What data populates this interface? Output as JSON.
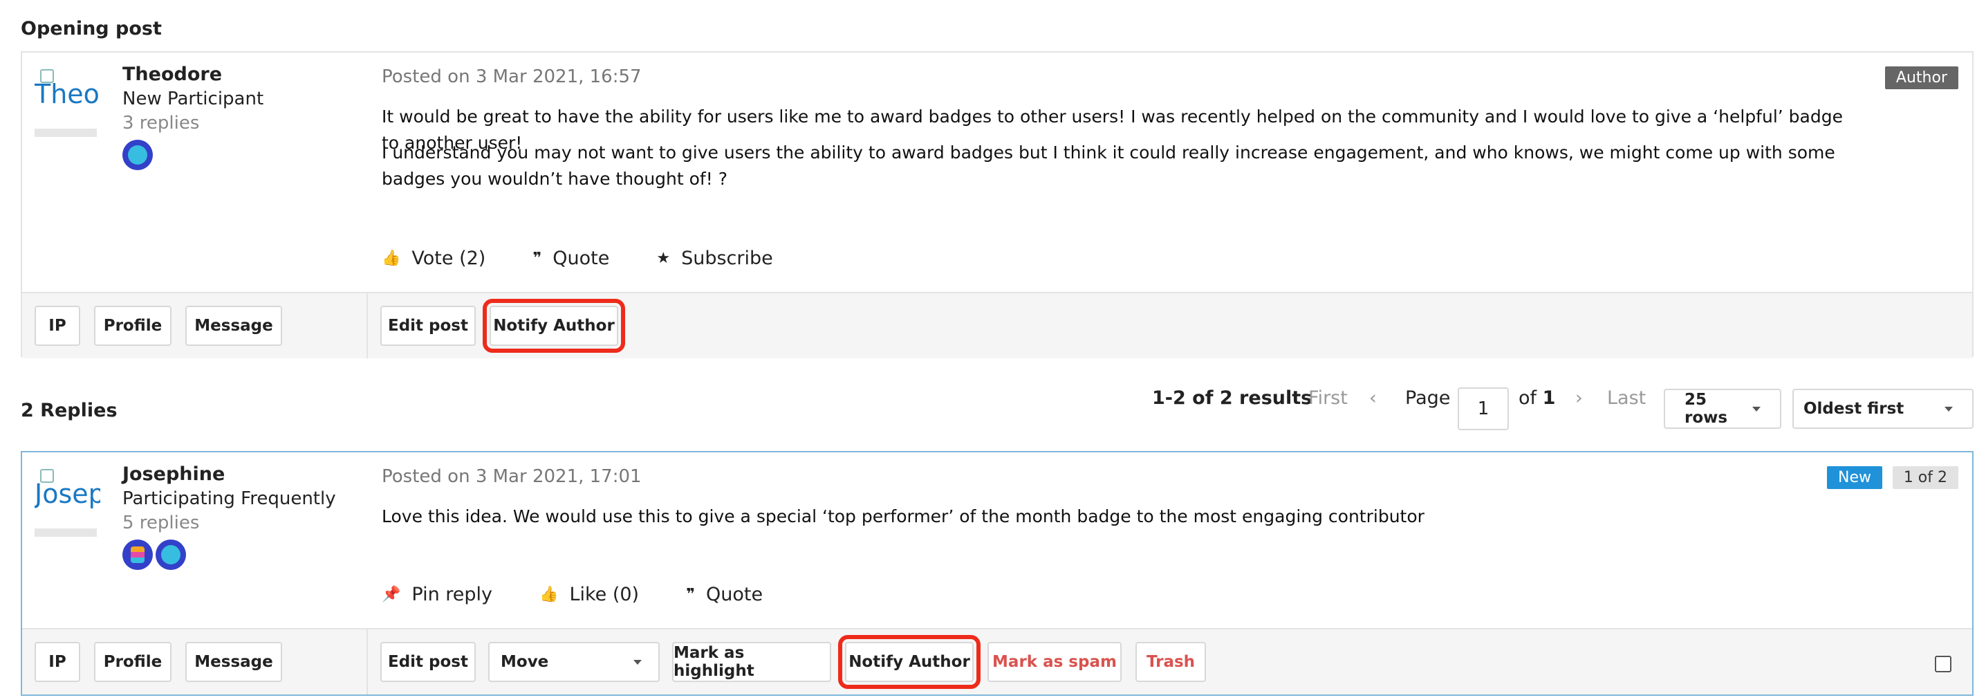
{
  "opening_heading": "Opening post",
  "replies_heading": "2 Replies",
  "opening": {
    "avatar_alt": "Theodore",
    "name": "Theodore",
    "rank": "New Participant",
    "replies": "3 replies",
    "posted": "Posted on 3 Mar 2021, 16:57",
    "tag": "Author",
    "text1": "It would be great to have the ability for users like me to award badges to other users! I was recently helped on the community and I would love to give a ‘helpful’ badge to another user!",
    "text2": "I understand you may not want to give users the ability to award badges but I think it could really increase engagement, and who knows, we might come up with some badges you wouldn’t have thought of! ?",
    "actions": [
      "Vote (2)",
      "Quote",
      "Subscribe"
    ],
    "left_buttons": [
      "IP",
      "Profile",
      "Message"
    ],
    "edit": "Edit post",
    "notify": "Notify Author"
  },
  "pager": {
    "results": "1-2 of 2 results",
    "first": "First",
    "page_label": "Page",
    "page_value": "1",
    "of": "of",
    "total": "1",
    "last": "Last",
    "rows": "25 rows",
    "sort": "Oldest first"
  },
  "reply": {
    "avatar_alt": "Josephine",
    "name": "Josephine",
    "rank": "Participating Frequently",
    "replies": "5 replies",
    "posted": "Posted on 3 Mar 2021, 17:01",
    "tag_new": "New",
    "tag_count": "1 of 2",
    "text": "Love this idea. We would use this to give a special ‘top performer’ of the month badge to the most engaging contributor",
    "actions": [
      "Pin reply",
      "Like (0)",
      "Quote"
    ],
    "left_buttons": [
      "IP",
      "Profile",
      "Message"
    ],
    "edit": "Edit post",
    "move": "Move",
    "highlight": "Mark as highlight",
    "notify": "Notify Author",
    "spam": "Mark as spam",
    "trash": "Trash"
  }
}
